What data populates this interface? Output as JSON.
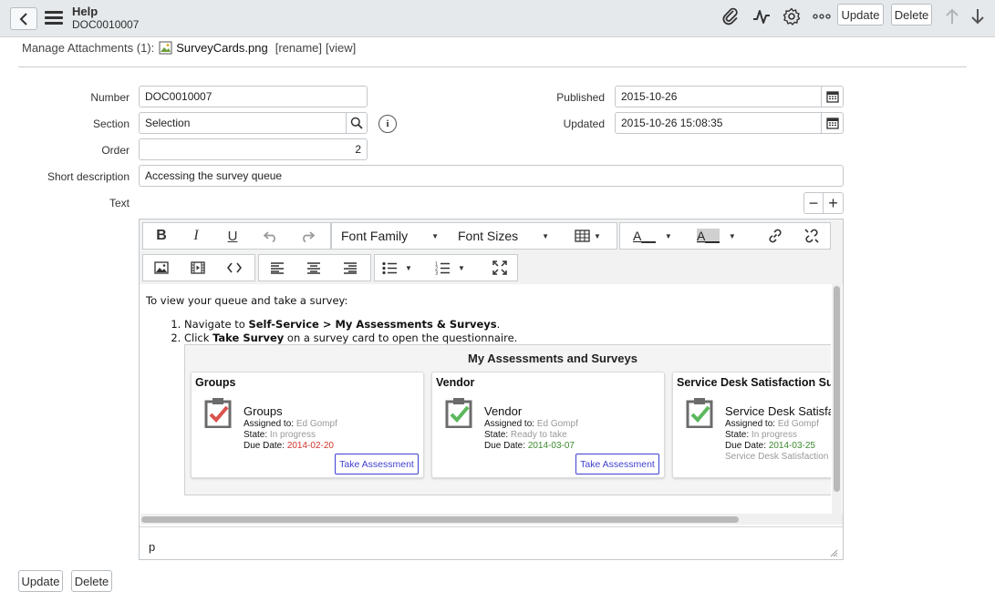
{
  "header": {
    "title": "Help",
    "subtitle": "DOC0010007",
    "update_label": "Update",
    "delete_label": "Delete"
  },
  "attachments": {
    "label": "Manage Attachments (1):",
    "file_name": "SurveyCards.png",
    "rename_label": "[rename]",
    "view_label": "[view]"
  },
  "form": {
    "number_label": "Number",
    "number_value": "DOC0010007",
    "section_label": "Section",
    "section_value": "Selection",
    "order_label": "Order",
    "order_value": "2",
    "short_desc_label": "Short description",
    "short_desc_value": "Accessing the survey queue",
    "text_label": "Text",
    "published_label": "Published",
    "published_value": "2015-10-26",
    "updated_label": "Updated",
    "updated_value": "2015-10-26 15:08:35"
  },
  "toolbar": {
    "font_family": "Font Family",
    "font_sizes": "Font Sizes"
  },
  "content": {
    "intro": "To view your queue and take a survey:",
    "step1_prefix": "Navigate to ",
    "step1_bold": "Self-Service > My Assessments & Surveys",
    "step1_suffix": ".",
    "step2_prefix": "Click ",
    "step2_bold": "Take Survey",
    "step2_suffix": " on a survey card to open the questionnaire.",
    "status_path": "p"
  },
  "screenshot": {
    "title": "My Assessments and Surveys",
    "cards": [
      {
        "header": "Groups",
        "name": "Groups",
        "assigned_label": "Assigned to:",
        "assigned": "Ed Gompf",
        "state_label": "State:",
        "state": "In progress",
        "due_label": "Due Date:",
        "due": "2014-02-20",
        "due_color": "#d0342c",
        "button": "Take Assessment"
      },
      {
        "header": "Vendor",
        "name": "Vendor",
        "assigned_label": "Assigned to:",
        "assigned": "Ed Gompf",
        "state_label": "State:",
        "state": "Ready to take",
        "due_label": "Due Date:",
        "due": "2014-03-07",
        "due_color": "#3c8a2e",
        "button": "Take Assessment"
      },
      {
        "header": "Service Desk Satisfaction Su",
        "name": "Service Desk Satisfa",
        "assigned_label": "Assigned to:",
        "assigned": "Ed Gompf",
        "state_label": "State:",
        "state": "In progress",
        "due_label": "Due Date:",
        "due": "2014-03-25",
        "due_color": "#3c8a2e",
        "extra": "Service Desk Satisfaction"
      }
    ]
  },
  "footer": {
    "update_label": "Update",
    "delete_label": "Delete"
  },
  "colors": {
    "header_bg": "#e6e9eb",
    "link_blue": "#3f3fd1",
    "due_red": "#d0342c",
    "due_green": "#3c8a2e",
    "check_red": "#d9534f",
    "check_green": "#5cb85c"
  }
}
